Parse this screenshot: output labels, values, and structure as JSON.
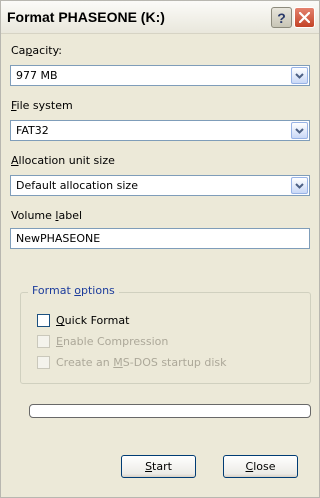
{
  "window": {
    "title": "Format PHASEONE (K:)",
    "help_glyph": "?"
  },
  "capacity": {
    "label_pre": "Ca",
    "label_key": "p",
    "label_post": "acity:",
    "value": "977 MB"
  },
  "file_system": {
    "label_key": "F",
    "label_post": "ile system",
    "value": "FAT32"
  },
  "allocation": {
    "label_key": "A",
    "label_post": "llocation unit size",
    "value": "Default allocation size"
  },
  "volume": {
    "label_pre": "Volume ",
    "label_key": "l",
    "label_post": "abel",
    "value": "NewPHASEONE"
  },
  "format_options": {
    "legend_pre": "Format ",
    "legend_key": "o",
    "legend_post": "ptions",
    "quick": {
      "key": "Q",
      "rest": "uick Format",
      "checked": false,
      "enabled": true
    },
    "compression": {
      "key": "E",
      "rest": "nable Compression",
      "checked": false,
      "enabled": false
    },
    "startup": {
      "pre": "Create an ",
      "key": "M",
      "rest": "S-DOS startup disk",
      "checked": false,
      "enabled": false
    }
  },
  "progress": {
    "fraction": 0
  },
  "buttons": {
    "start_key": "S",
    "start_rest": "tart",
    "close_key": "C",
    "close_rest": "lose"
  }
}
